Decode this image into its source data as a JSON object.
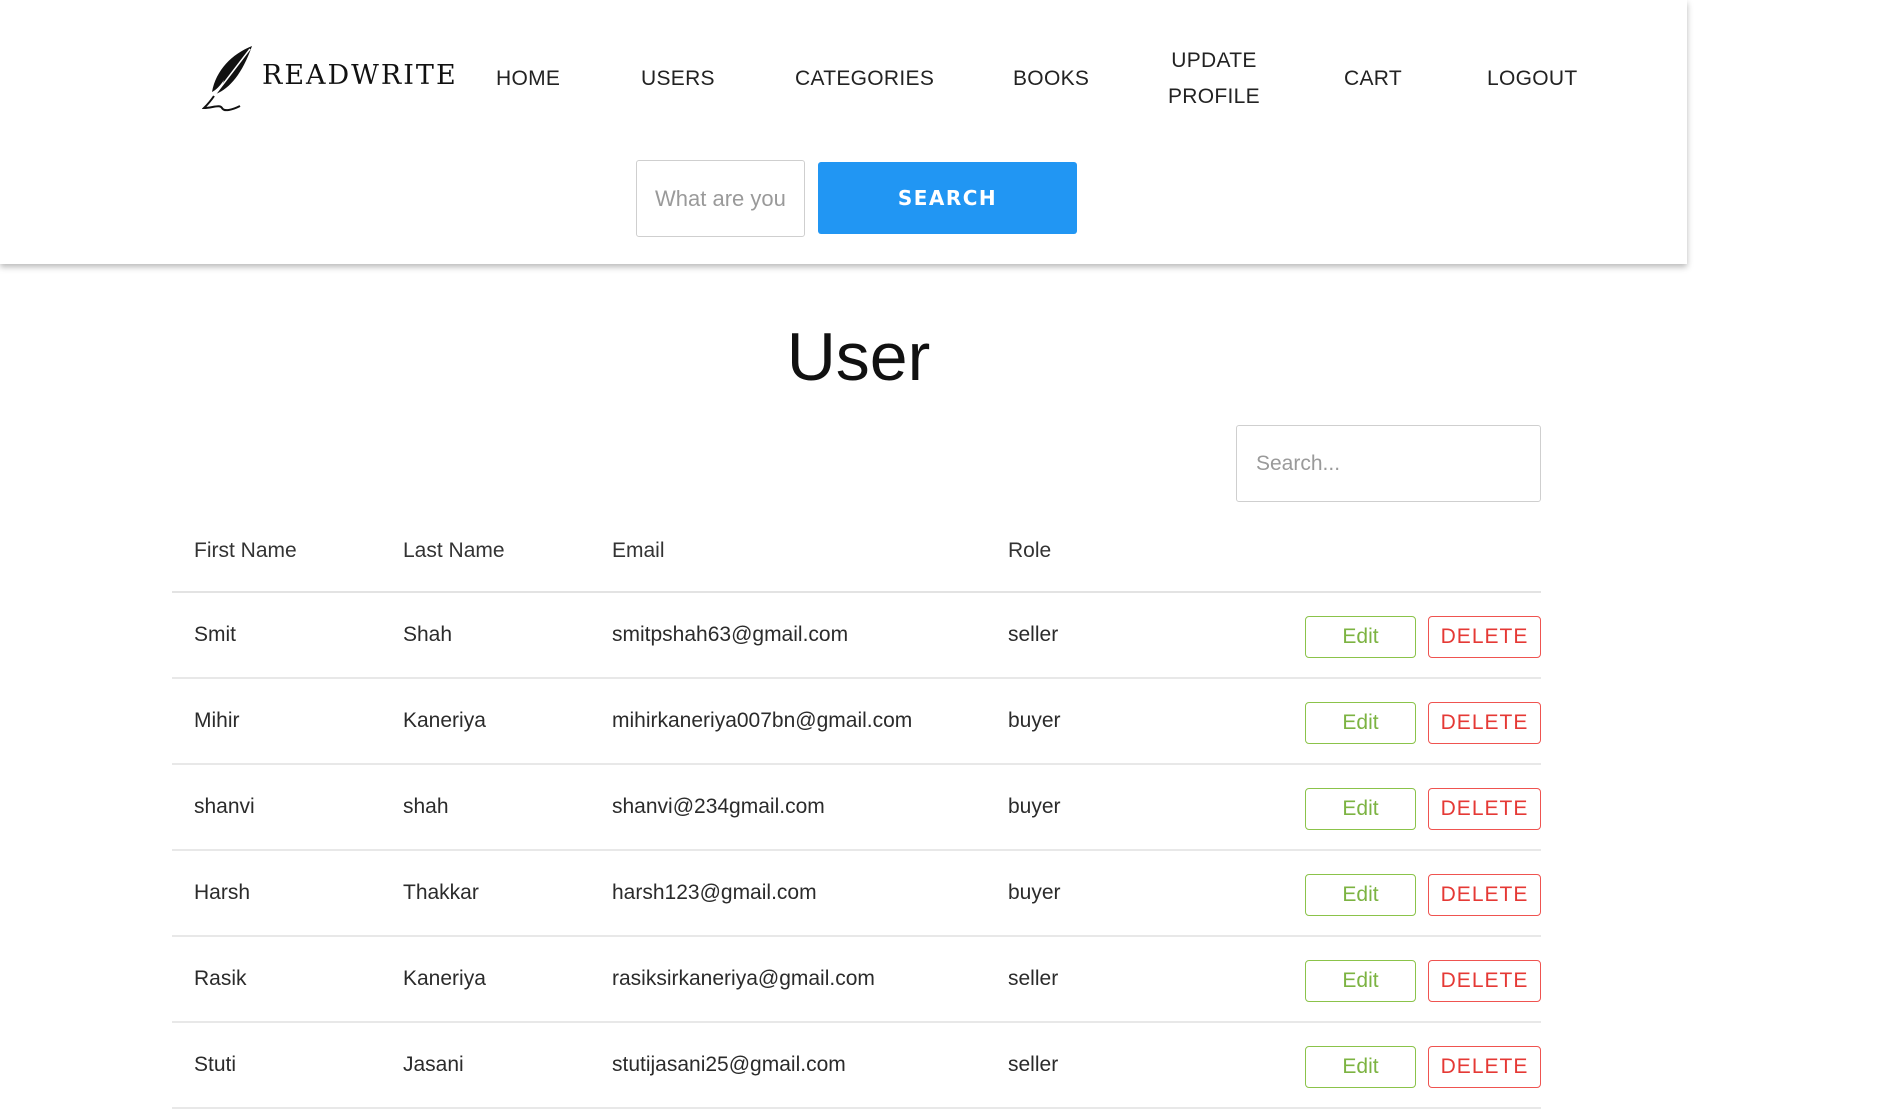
{
  "brand": {
    "name": "READWRITE"
  },
  "nav": {
    "home": "HOME",
    "users": "USERS",
    "categories": "CATEGORIES",
    "books": "BOOKS",
    "update_line1": "UPDATE",
    "update_line2": "PROFILE",
    "cart": "CART",
    "logout": "LOGOUT"
  },
  "search": {
    "placeholder": "What are you looking for?",
    "button_label": "SEARCH"
  },
  "page": {
    "title": "User"
  },
  "table_search": {
    "placeholder": "Search..."
  },
  "table": {
    "headers": {
      "first": "First Name",
      "last": "Last Name",
      "email": "Email",
      "role": "Role"
    },
    "edit_label": "Edit",
    "delete_label": "DELETE",
    "rows": [
      {
        "first": "Smit",
        "last": "Shah",
        "email": "smitpshah63@gmail.com",
        "role": "seller"
      },
      {
        "first": "Mihir",
        "last": "Kaneriya",
        "email": "mihirkaneriya007bn@gmail.com",
        "role": "buyer"
      },
      {
        "first": "shanvi",
        "last": "shah",
        "email": "shanvi@234gmail.com",
        "role": "buyer"
      },
      {
        "first": "Harsh",
        "last": "Thakkar",
        "email": "harsh123@gmail.com",
        "role": "buyer"
      },
      {
        "first": "Rasik",
        "last": "Kaneriya",
        "email": "rasiksirkaneriya@gmail.com",
        "role": "seller"
      },
      {
        "first": "Stuti",
        "last": "Jasani",
        "email": "stutijasani25@gmail.com",
        "role": "seller"
      }
    ]
  },
  "colors": {
    "primary": "#2196f3",
    "edit": "#7cb342",
    "delete": "#e53935"
  },
  "icons": {
    "logo": "quill-feather-icon"
  }
}
